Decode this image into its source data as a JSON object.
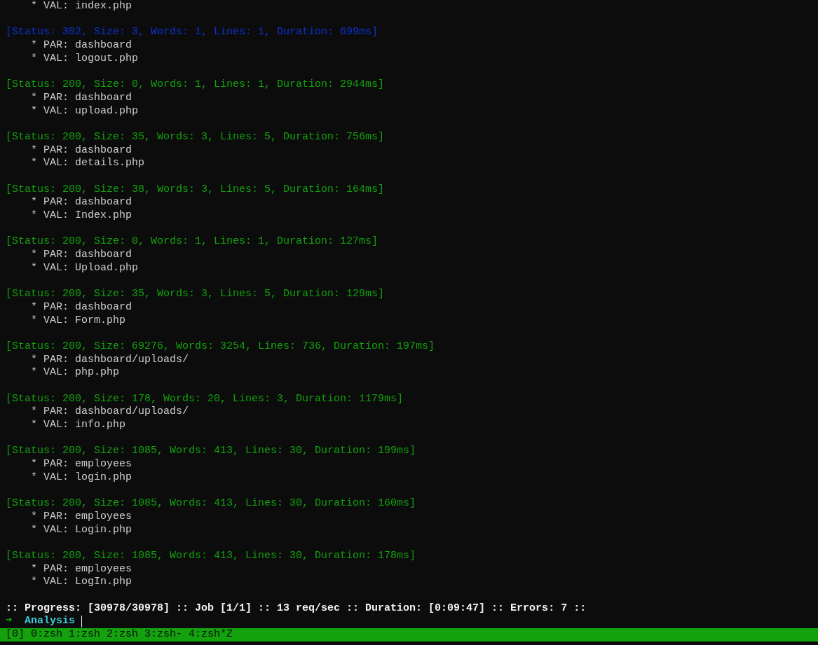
{
  "top_line": "* VAL: index.php",
  "results": [
    {
      "status_line": "[Status: 302, Size: 3, Words: 1, Lines: 1, Duration: 699ms]",
      "color": "#0c33d6",
      "par": "* PAR: dashboard",
      "val": "* VAL: logout.php"
    },
    {
      "status_line": "[Status: 200, Size: 0, Words: 1, Lines: 1, Duration: 2944ms]",
      "color": "#13a10e",
      "par": "* PAR: dashboard",
      "val": "* VAL: upload.php"
    },
    {
      "status_line": "[Status: 200, Size: 35, Words: 3, Lines: 5, Duration: 756ms]",
      "color": "#13a10e",
      "par": "* PAR: dashboard",
      "val": "* VAL: details.php"
    },
    {
      "status_line": "[Status: 200, Size: 38, Words: 3, Lines: 5, Duration: 164ms]",
      "color": "#13a10e",
      "par": "* PAR: dashboard",
      "val": "* VAL: Index.php"
    },
    {
      "status_line": "[Status: 200, Size: 0, Words: 1, Lines: 1, Duration: 127ms]",
      "color": "#13a10e",
      "par": "* PAR: dashboard",
      "val": "* VAL: Upload.php"
    },
    {
      "status_line": "[Status: 200, Size: 35, Words: 3, Lines: 5, Duration: 129ms]",
      "color": "#13a10e",
      "par": "* PAR: dashboard",
      "val": "* VAL: Form.php"
    },
    {
      "status_line": "[Status: 200, Size: 69276, Words: 3254, Lines: 736, Duration: 197ms]",
      "color": "#13a10e",
      "par": "* PAR: dashboard/uploads/",
      "val": "* VAL: php.php"
    },
    {
      "status_line": "[Status: 200, Size: 178, Words: 20, Lines: 3, Duration: 1179ms]",
      "color": "#13a10e",
      "par": "* PAR: dashboard/uploads/",
      "val": "* VAL: info.php"
    },
    {
      "status_line": "[Status: 200, Size: 1085, Words: 413, Lines: 30, Duration: 199ms]",
      "color": "#13a10e",
      "par": "* PAR: employees",
      "val": "* VAL: login.php"
    },
    {
      "status_line": "[Status: 200, Size: 1085, Words: 413, Lines: 30, Duration: 160ms]",
      "color": "#13a10e",
      "par": "* PAR: employees",
      "val": "* VAL: Login.php"
    },
    {
      "status_line": "[Status: 200, Size: 1085, Words: 413, Lines: 30, Duration: 178ms]",
      "color": "#13a10e",
      "par": "* PAR: employees",
      "val": "* VAL: LogIn.php"
    }
  ],
  "progress_line": ":: Progress: [30978/30978] :: Job [1/1] :: 13 req/sec :: Duration: [0:09:47] :: Errors: 7 ::",
  "prompt": {
    "arrow": "➜",
    "directory": "Analysis"
  },
  "tmux_bar": {
    "session": "[0]",
    "windows": [
      "0:zsh",
      "1:zsh",
      "2:zsh",
      "3:zsh-",
      "4:zsh*Z"
    ]
  }
}
